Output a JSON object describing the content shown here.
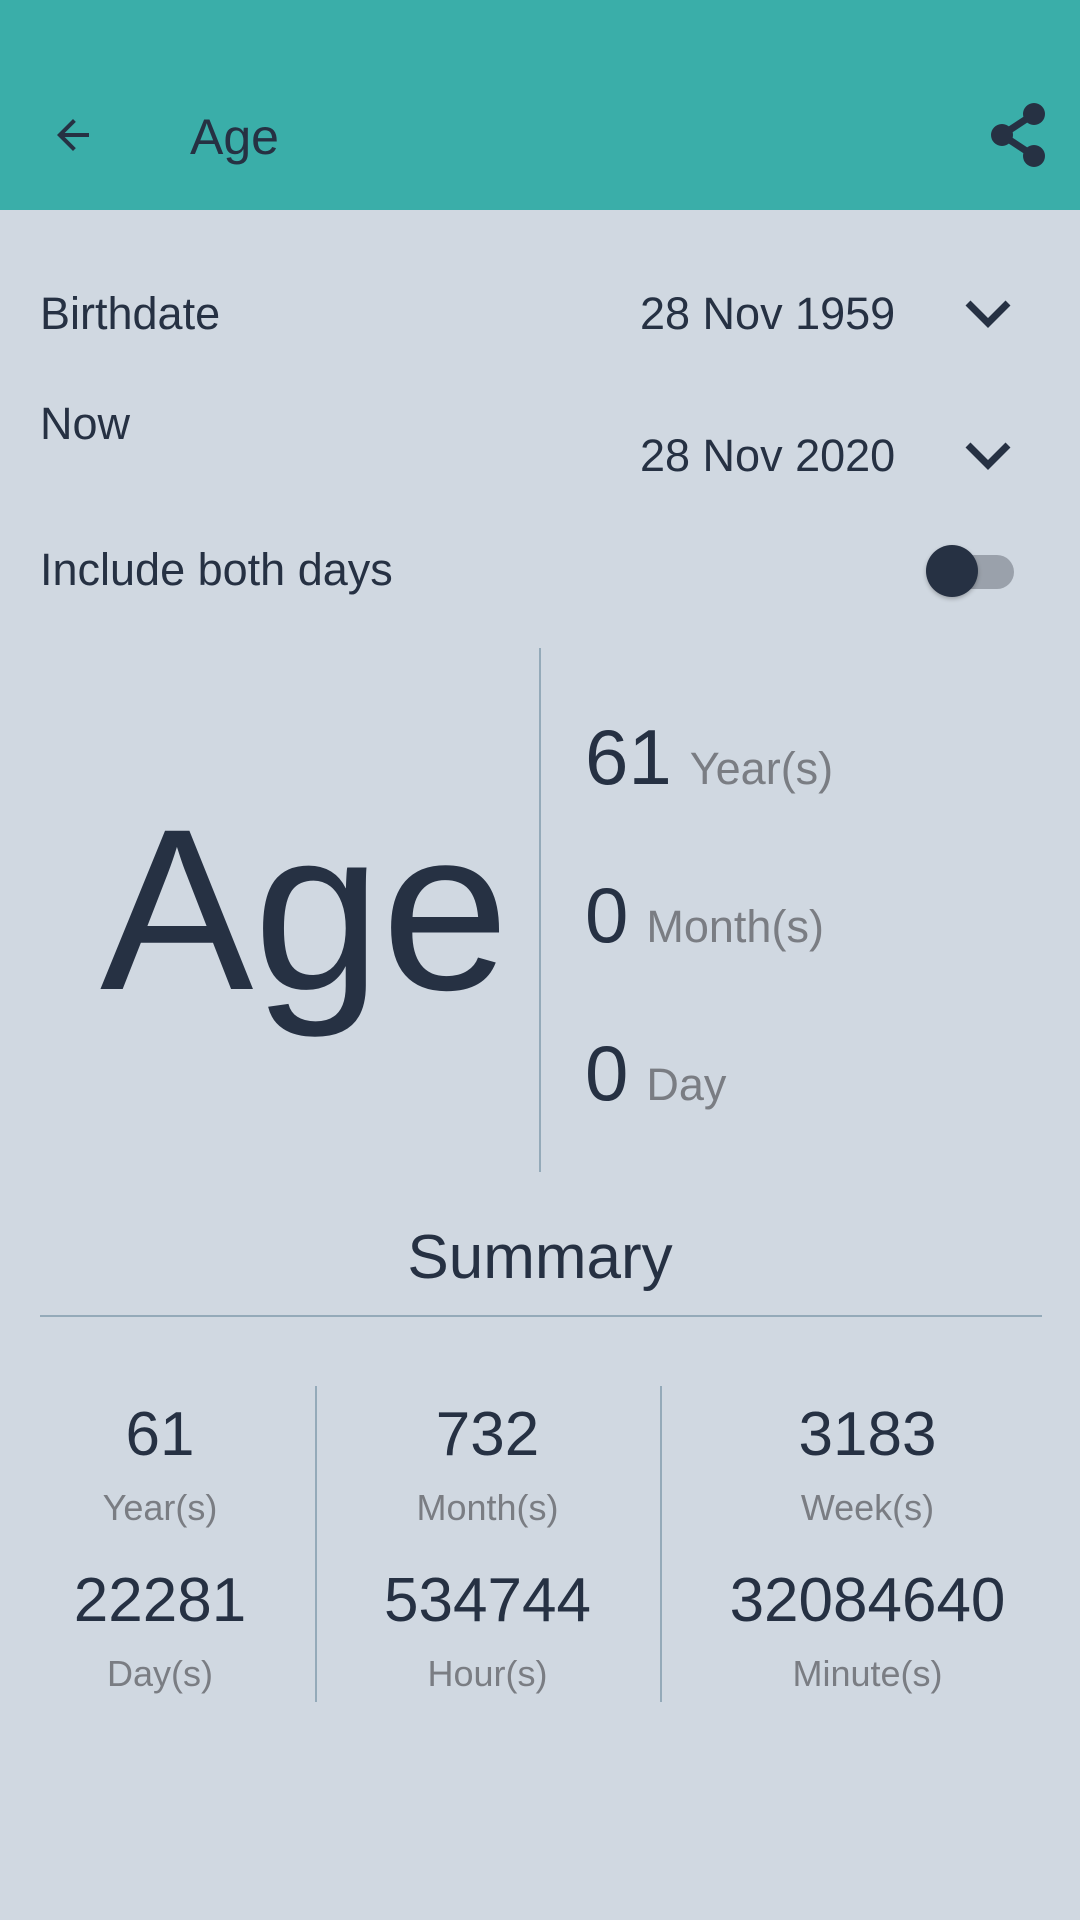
{
  "appbar": {
    "title": "Age",
    "back_icon": "arrow-left-icon",
    "share_icon": "share-icon",
    "color": "#3aaea9"
  },
  "form": {
    "birthdate_label": "Birthdate",
    "birthdate_value": "28 Nov 1959",
    "now_label": "Now",
    "now_value": "28 Nov 2020",
    "include_both_days_label": "Include both days",
    "include_both_days_on": false
  },
  "age": {
    "big_label": "Age",
    "years": {
      "value": "61",
      "unit": "Year(s)"
    },
    "months": {
      "value": "0",
      "unit": "Month(s)"
    },
    "days": {
      "value": "0",
      "unit": "Day"
    }
  },
  "summary": {
    "title": "Summary",
    "items": [
      {
        "value": "61",
        "unit": "Year(s)"
      },
      {
        "value": "732",
        "unit": "Month(s)"
      },
      {
        "value": "3183",
        "unit": "Week(s)"
      },
      {
        "value": "22281",
        "unit": "Day(s)"
      },
      {
        "value": "534744",
        "unit": "Hour(s)"
      },
      {
        "value": "32084640",
        "unit": "Minute(s)"
      }
    ]
  }
}
